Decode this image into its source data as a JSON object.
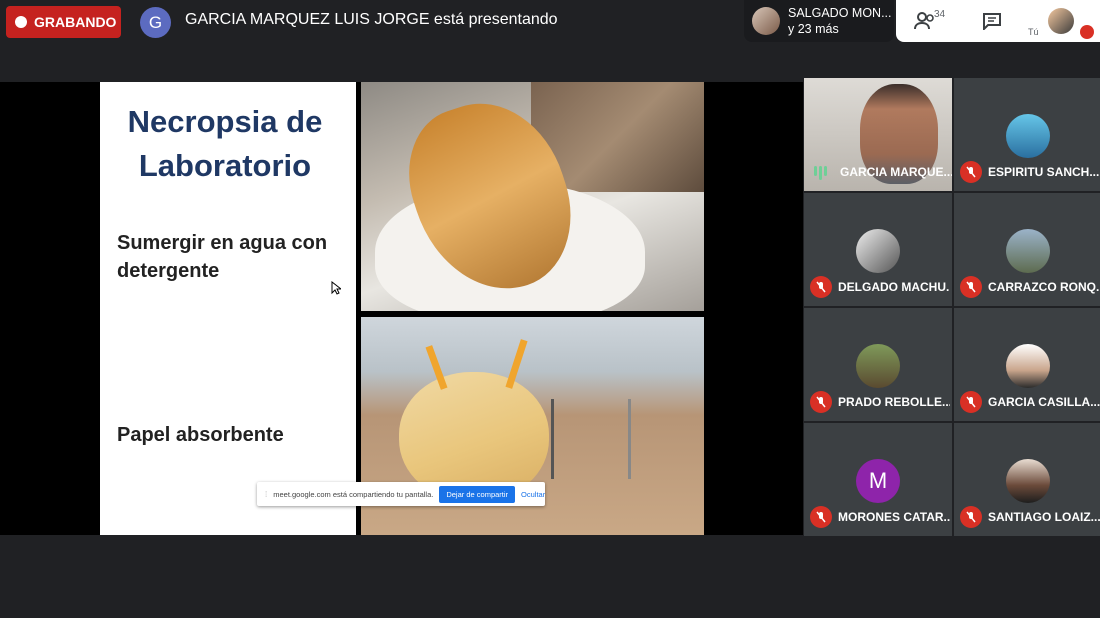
{
  "top_bar": {
    "recording_label": "GRABANDO",
    "presenter_initial": "G",
    "presenting_text": "GARCIA MARQUEZ LUIS JORGE está presentando",
    "others": {
      "name": "SALGADO MON...",
      "more": "y 23 más"
    },
    "participant_count": "34",
    "self_label": "Tú"
  },
  "slide": {
    "title": "Necropsia de Laboratorio",
    "bullet_1": "Sumergir en agua con detergente",
    "bullet_2": "Papel absorbente"
  },
  "share_bar": {
    "message": "meet.google.com está compartiendo tu pantalla.",
    "stop_label": "Dejar de compartir",
    "hide_label": "Ocultar"
  },
  "tiles": [
    {
      "name": "GARCIA MARQUE...",
      "speaking": true
    },
    {
      "name": "ESPIRITU SANCH..."
    },
    {
      "name": "DELGADO MACHU..."
    },
    {
      "name": "CARRAZCO RONQ..."
    },
    {
      "name": "PRADO REBOLLE..."
    },
    {
      "name": "GARCIA CASILLA..."
    },
    {
      "name": "MORONES CATAR...",
      "initial": "M"
    },
    {
      "name": "SANTIAGO LOAIZ..."
    }
  ],
  "colors": {
    "record": "#c5221f",
    "mute": "#d93025",
    "accent": "#1a73e8",
    "slide_title": "#1f3864"
  }
}
